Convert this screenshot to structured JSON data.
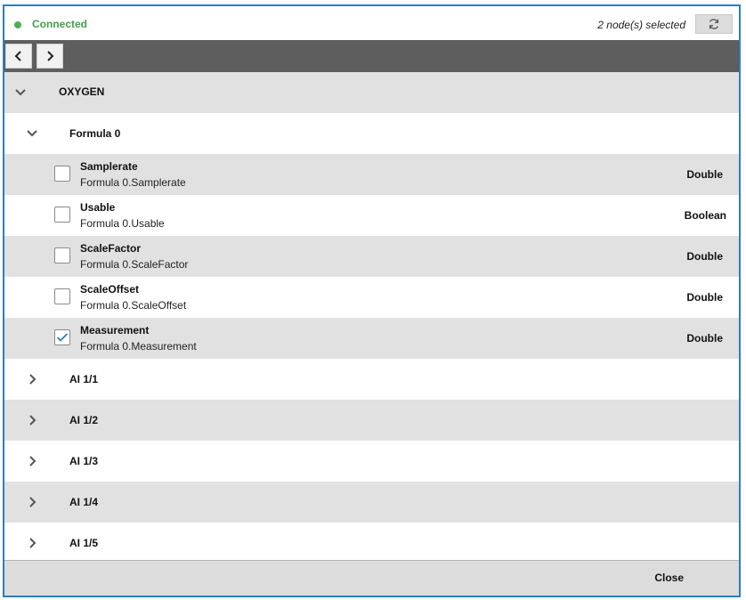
{
  "status": {
    "text": "Connected",
    "color": "#43a047",
    "icon": "status-dot-icon"
  },
  "selection": {
    "text": "2 node(s) selected"
  },
  "refresh": {
    "icon": "refresh-icon"
  },
  "nav": {
    "back_icon": "chevron-left-icon",
    "forward_icon": "chevron-right-icon"
  },
  "tree": {
    "root": {
      "label": "OXYGEN",
      "expanded": true
    },
    "formula": {
      "label": "Formula 0",
      "expanded": true
    },
    "items": [
      {
        "name": "Samplerate",
        "path": "Formula 0.Samplerate",
        "type": "Double",
        "checked": false
      },
      {
        "name": "Usable",
        "path": "Formula 0.Usable",
        "type": "Boolean",
        "checked": false
      },
      {
        "name": "ScaleFactor",
        "path": "Formula 0.ScaleFactor",
        "type": "Double",
        "checked": false
      },
      {
        "name": "ScaleOffset",
        "path": "Formula 0.ScaleOffset",
        "type": "Double",
        "checked": false
      },
      {
        "name": "Measurement",
        "path": "Formula 0.Measurement",
        "type": "Double",
        "checked": true
      }
    ],
    "groups": [
      {
        "label": "AI 1/1",
        "expanded": false
      },
      {
        "label": "AI 1/2",
        "expanded": false
      },
      {
        "label": "AI 1/3",
        "expanded": false
      },
      {
        "label": "AI 1/4",
        "expanded": false
      },
      {
        "label": "AI 1/5",
        "expanded": false
      }
    ]
  },
  "footer": {
    "close_label": "Close"
  },
  "colors": {
    "accent": "#2a7fc1",
    "toolbar": "#5e5e5e",
    "row_alt": "#e1e1e1"
  }
}
